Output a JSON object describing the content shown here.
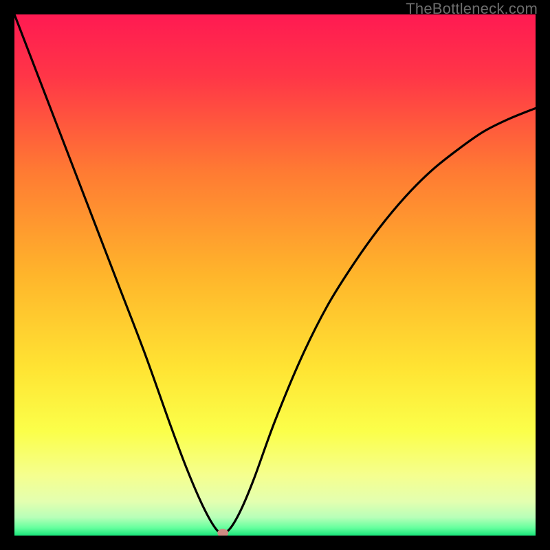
{
  "watermark": "TheBottleneck.com",
  "chart_data": {
    "type": "line",
    "title": "",
    "xlabel": "",
    "ylabel": "",
    "xlim": [
      0,
      100
    ],
    "ylim": [
      0,
      100
    ],
    "series": [
      {
        "name": "curve",
        "x": [
          0,
          5,
          10,
          15,
          20,
          25,
          30,
          33,
          36,
          38.5,
          40,
          41.5,
          43.5,
          46,
          50,
          55,
          60,
          65,
          70,
          75,
          80,
          85,
          90,
          95,
          100
        ],
        "y": [
          100,
          87,
          74,
          61,
          48,
          35,
          21,
          13,
          6,
          1.5,
          0.5,
          1.5,
          5,
          11,
          22,
          34,
          44,
          52,
          59,
          65,
          70,
          74,
          77.5,
          80,
          82
        ]
      }
    ],
    "marker": {
      "x": 40,
      "y": 0.5
    },
    "gradient_stops": [
      {
        "pct": 0.0,
        "color": "#ff1a52"
      },
      {
        "pct": 0.12,
        "color": "#ff3647"
      },
      {
        "pct": 0.3,
        "color": "#ff7a33"
      },
      {
        "pct": 0.5,
        "color": "#ffb52b"
      },
      {
        "pct": 0.68,
        "color": "#ffe433"
      },
      {
        "pct": 0.8,
        "color": "#fbff4a"
      },
      {
        "pct": 0.885,
        "color": "#f5ff8f"
      },
      {
        "pct": 0.935,
        "color": "#e3ffb0"
      },
      {
        "pct": 0.965,
        "color": "#b8ffb8"
      },
      {
        "pct": 0.985,
        "color": "#66ff9e"
      },
      {
        "pct": 1.0,
        "color": "#19e57a"
      }
    ]
  }
}
